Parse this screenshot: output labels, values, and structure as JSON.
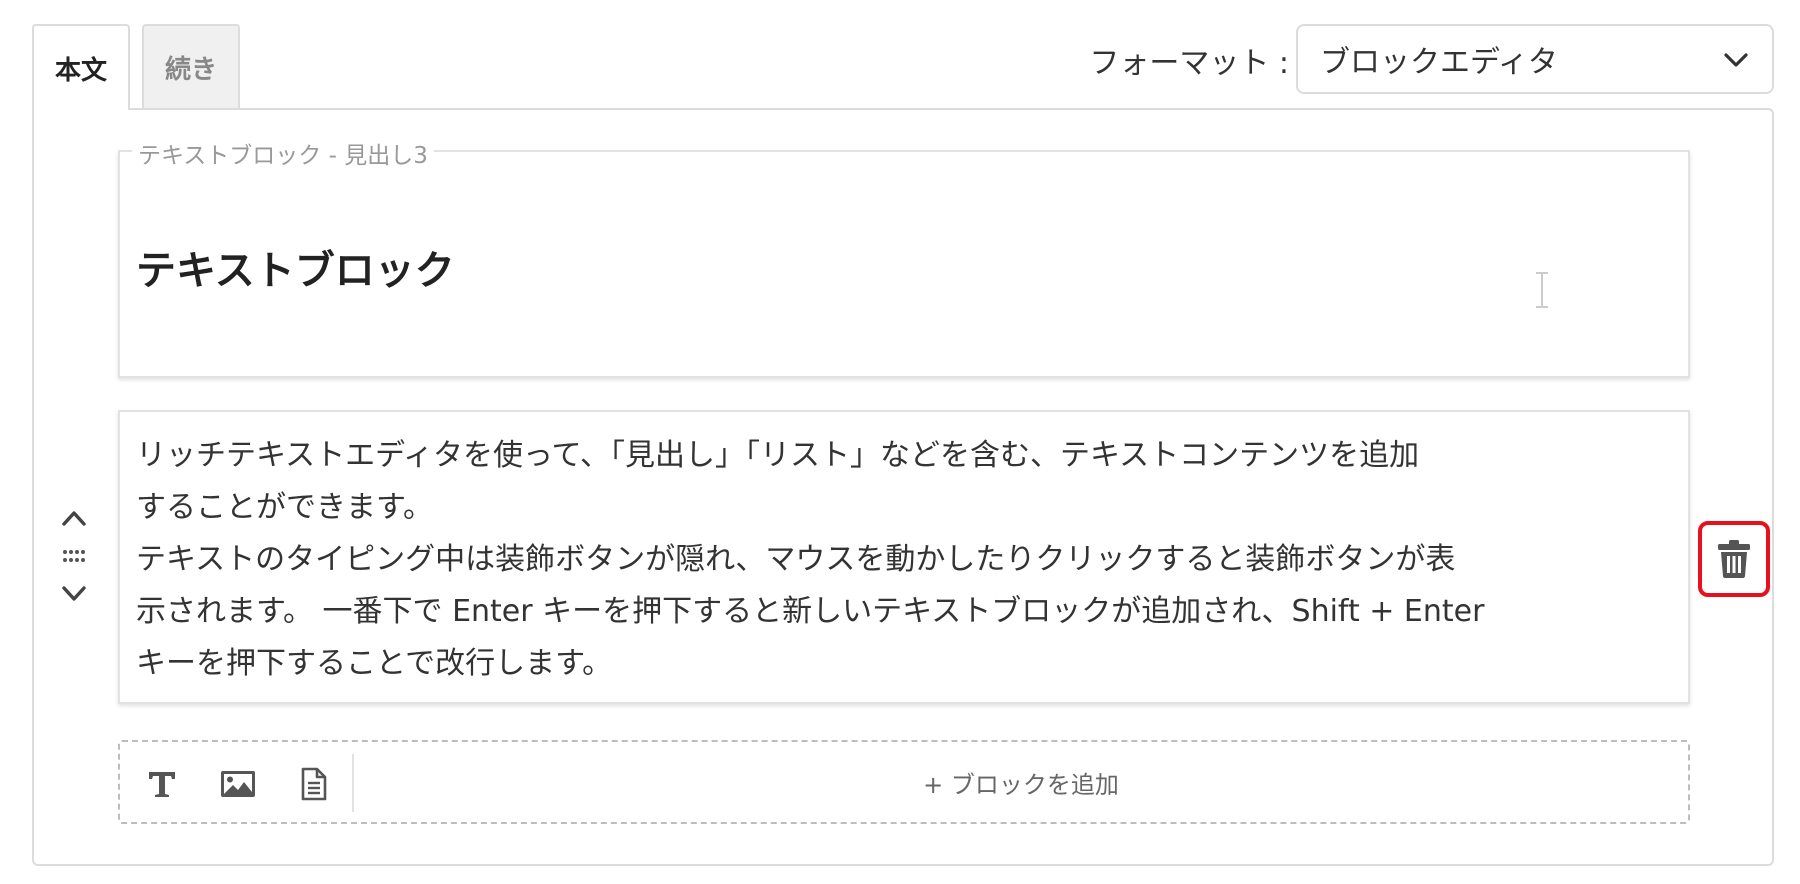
{
  "tabs": [
    {
      "label": "本文",
      "active": true
    },
    {
      "label": "続き",
      "active": false
    }
  ],
  "format": {
    "label": "フォーマット :",
    "selected": "ブロックエディタ"
  },
  "heading_block": {
    "legend": "テキストブロック - 見出し3",
    "text": "テキストブロック"
  },
  "rich_block": {
    "lines": [
      "リッチテキストエディタを使って、「見出し」「リスト」などを含む、テキストコンテンツを追加",
      "することができます。",
      "テキストのタイピング中は装飾ボタンが隠れ、マウスを動かしたりクリックすると装飾ボタンが表",
      "示されます。 一番下で Enter キーを押下すると新しいテキストブロックが追加され、Shift + Enter",
      "キーを押下することで改行します。"
    ]
  },
  "controls": {
    "move_up_icon": "chevron-up-icon",
    "drag_icon": "drag-handle-icon",
    "move_down_icon": "chevron-down-icon",
    "delete_icon": "trash-icon"
  },
  "add_bar": {
    "tools": [
      "text-icon",
      "image-icon",
      "document-icon"
    ],
    "label": "+ ブロックを追加"
  },
  "colors": {
    "highlight": "#e8101c",
    "border": "#dcdcdc",
    "text": "#333333",
    "muted": "#999999"
  }
}
